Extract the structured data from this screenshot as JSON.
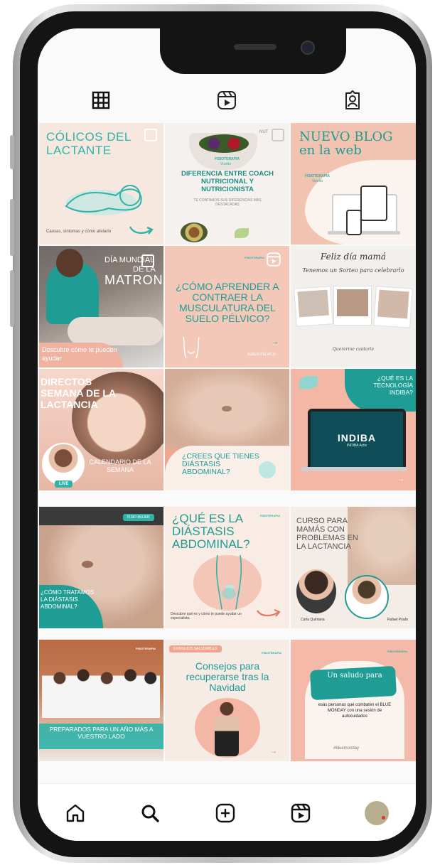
{
  "profile_tabs": [
    {
      "name": "grid-icon"
    },
    {
      "name": "reels-icon"
    },
    {
      "name": "tagged-icon"
    }
  ],
  "posts": {
    "p1": {
      "title": "CÓLICOS DEL LACTANTE",
      "caption": "Causas, síntomas y cómo aliviarlo"
    },
    "p2": {
      "brand": "FISIOTERAPIA",
      "brand_sub": "Vizetto",
      "title": "DIFERENCIA ENTRE COACH NUTRICIONAL Y NUTRICIONISTA",
      "subtitle": "TE CONTAMOS SUS DIFERENCIAS MÁS DESTACADAS",
      "corner": "NUT"
    },
    "p3": {
      "title": "NUEVO BLOG en la web",
      "brand": "FISIOTERAPIA",
      "brand_sub": "Vizetto"
    },
    "p4": {
      "pre": "DÍA MUNDIAL",
      "mid": "DE LA",
      "title": "MATRONA",
      "caption": "Descubre cómo te pueden ayudar"
    },
    "p5": {
      "brand": "FISIOTERAPIA",
      "title": "¿CÓMO APRENDER A CONTRAER LA MUSCULATURA DEL SUELO PÉLVICO?",
      "footer": "SUELO PÉLVICO"
    },
    "p6": {
      "title": "Feliz día mamá",
      "subtitle": "Tenemos un Sorteo para celebrarlo",
      "footer": "Quererme cuidarte"
    },
    "p7": {
      "title": "DIRECTOS SEMANA DE LA LACTANCIA",
      "caption": "CALENDARIO DE LA SEMANA",
      "live": "LIVE"
    },
    "p8": {
      "title": "¿CREES QUE TIENES DIÁSTASIS ABDOMINAL?"
    },
    "p9": {
      "title": "¿QUÉ ES LA TECNOLOGÍA INDIBA?",
      "screen": "INDIBA",
      "screen_sub": "INDIBA Activ"
    },
    "p10": {
      "tag": "FISIO MUJER",
      "caption": "¿CÓMO TRATAMOS LA DIÁSTASIS ABDOMINAL?"
    },
    "p11": {
      "brand": "FISIOTERAPIA",
      "title": "¿QUÉ ES LA DIÁSTASIS ABDOMINAL?",
      "caption": "Descubre qué es y cómo te puede ayudar un especialista."
    },
    "p12": {
      "title": "CURSO PARA MAMÁS CON PROBLEMAS EN LA LACTANCIA",
      "left_name": "Carla Quintana",
      "right_name": "Rafael Prado"
    },
    "p13": {
      "brand": "FISIOTERAPIA",
      "caption": "PREPARADOS PARA UN AÑO MÁS A VUESTRO LADO"
    },
    "p14": {
      "tag": "CONSEJOS SALUDABLES",
      "brand": "FISIOTERAPIA",
      "title": "Consejos para recuperarse tras la Navidad"
    },
    "p15": {
      "brand": "FISIOTERAPIA",
      "title": "Un saludo para",
      "body": "esas personas que combaten el BLUE MONDAY con una sesión de autocuidados",
      "footer": "#bluemonday"
    }
  },
  "bottom_nav": [
    {
      "name": "home-icon"
    },
    {
      "name": "search-icon"
    },
    {
      "name": "new-post-icon"
    },
    {
      "name": "reels-icon"
    },
    {
      "name": "profile-avatar"
    }
  ],
  "colors": {
    "teal": "#2fb3a8",
    "peach": "#f4c6b8",
    "blush": "#f7e4dc",
    "salmon": "#f1a58f"
  }
}
